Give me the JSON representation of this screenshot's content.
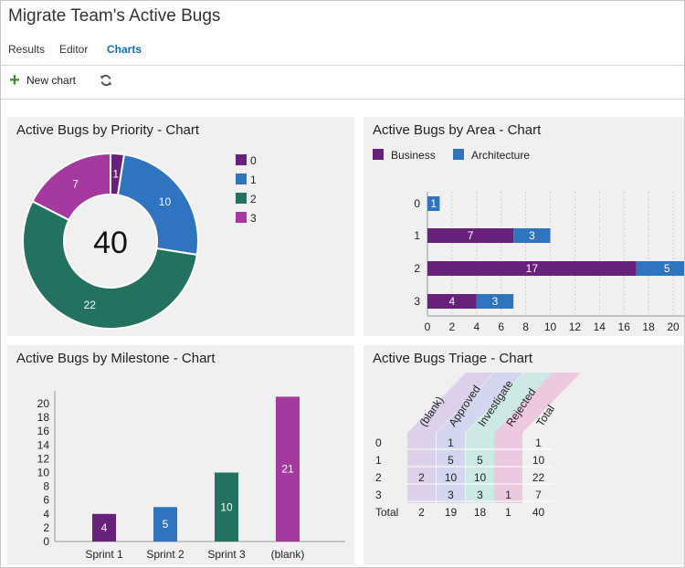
{
  "page": {
    "title": "Migrate Team's Active Bugs"
  },
  "tabs": [
    {
      "label": "Results",
      "active": false
    },
    {
      "label": "Editor",
      "active": false
    },
    {
      "label": "Charts",
      "active": true
    }
  ],
  "toolbar": {
    "new_chart_label": "New chart",
    "new_chart_icon": "plus-icon",
    "refresh_icon": "refresh-icon"
  },
  "colors": {
    "accent": "#106ebe",
    "purple": "#68217a",
    "blue": "#2f74be",
    "green": "#23725f",
    "magenta": "#a5399f"
  },
  "panels": {
    "priority": {
      "title": "Active Bugs by Priority - Chart",
      "total": "40"
    },
    "area": {
      "title": "Active Bugs by Area - Chart"
    },
    "milestone": {
      "title": "Active Bugs by Milestone - Chart"
    },
    "triage": {
      "title": "Active Bugs Triage - Chart"
    }
  },
  "chart_data": [
    {
      "type": "pie",
      "variant": "donut",
      "title": "Active Bugs by Priority - Chart",
      "center_label": "40",
      "categories": [
        "0",
        "1",
        "2",
        "3"
      ],
      "values": [
        1,
        10,
        22,
        7
      ],
      "colors": [
        "#68217a",
        "#2f74be",
        "#23725f",
        "#a5399f"
      ],
      "legend": "right"
    },
    {
      "type": "bar",
      "orientation": "horizontal",
      "stacked": true,
      "title": "Active Bugs by Area - Chart",
      "categories": [
        "0",
        "1",
        "2",
        "3"
      ],
      "series": [
        {
          "name": "Business",
          "values": [
            0,
            7,
            17,
            4
          ],
          "color": "#68217a"
        },
        {
          "name": "Architecture",
          "values": [
            1,
            3,
            5,
            3
          ],
          "color": "#2f74be"
        }
      ],
      "xticks": [
        0,
        2,
        4,
        6,
        8,
        10,
        12,
        14,
        16,
        18,
        20
      ],
      "xlim": [
        0,
        22
      ],
      "grid": true,
      "legend": "top-left"
    },
    {
      "type": "bar",
      "title": "Active Bugs by Milestone - Chart",
      "categories": [
        "Sprint  1",
        "Sprint  2",
        "Sprint 3",
        "(blank)"
      ],
      "values": [
        4,
        5,
        10,
        21
      ],
      "colors": [
        "#68217a",
        "#2f74be",
        "#23725f",
        "#a5399f"
      ],
      "yticks": [
        0,
        2,
        4,
        6,
        8,
        10,
        12,
        14,
        16,
        18,
        20
      ],
      "ylim": [
        0,
        21
      ]
    },
    {
      "type": "table",
      "title": "Active Bugs Triage - Chart",
      "columns": [
        "(blank)",
        "Approved",
        "Investigate",
        "Rejected",
        "Total"
      ],
      "column_colors": [
        "#dcd0ea",
        "#d2d6ee",
        "#cde9e6",
        "#ecc9df",
        "#ffffff"
      ],
      "rows": [
        {
          "label": "0",
          "cells": [
            "",
            "1",
            "",
            "",
            "1"
          ]
        },
        {
          "label": "1",
          "cells": [
            "",
            "5",
            "5",
            "",
            "10"
          ]
        },
        {
          "label": "2",
          "cells": [
            "2",
            "10",
            "10",
            "",
            "22"
          ]
        },
        {
          "label": "3",
          "cells": [
            "",
            "3",
            "3",
            "1",
            "7"
          ]
        },
        {
          "label": "Total",
          "cells": [
            "2",
            "19",
            "18",
            "1",
            "40"
          ]
        }
      ]
    }
  ]
}
